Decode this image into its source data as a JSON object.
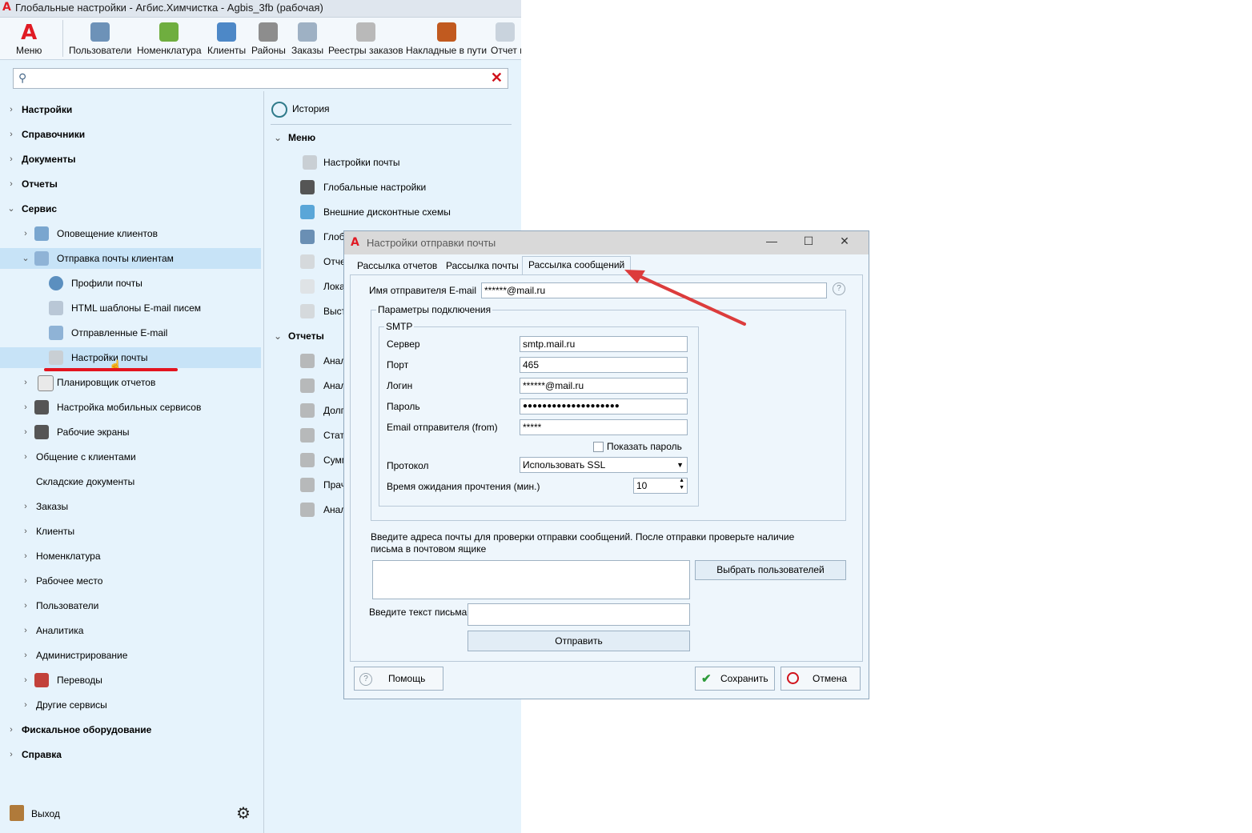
{
  "window": {
    "title": "Глобальные настройки - Агбис.Химчистка - Agbis_3fb (рабочая)"
  },
  "ribbon": {
    "menu_label": "Меню",
    "items": [
      "Пользователи",
      "Номенклатура",
      "Клиенты",
      "Районы",
      "Заказы",
      "Реестры заказов",
      "Накладные в пути",
      "Отчет в"
    ]
  },
  "search": {
    "value": ""
  },
  "nav": {
    "top": [
      "Настройки",
      "Справочники",
      "Документы",
      "Отчеты"
    ],
    "service": "Сервис",
    "service_items": [
      "Оповещение клиентов",
      "Отправка почты клиентам"
    ],
    "mail_children": [
      "Профили почты",
      "HTML шаблоны E-mail писем",
      "Отправленные E-mail",
      "Настройки почты"
    ],
    "service_rest": [
      "Планировщик отчетов",
      "Настройка мобильных сервисов",
      "Рабочие экраны",
      "Общение с клиентами",
      "Складские документы",
      "Заказы",
      "Клиенты",
      "Номенклатура",
      "Рабочее место",
      "Пользователи",
      "Аналитика",
      "Администрирование",
      "Переводы",
      "Другие сервисы"
    ],
    "bottom": [
      "Фискальное оборудование",
      "Справка"
    ],
    "exit": "Выход"
  },
  "right_panel": {
    "history": "История",
    "menu_header": "Меню",
    "menu_items": [
      "Настройки почты",
      "Глобальные настройки",
      "Внешние дисконтные схемы",
      "Глоб",
      "Отче",
      "Лока",
      "Выст"
    ],
    "reports_header": "Отчеты",
    "report_items": [
      "Анал",
      "Анал",
      "Долг",
      "Стат",
      "Сумм",
      "Прач",
      "Анал"
    ]
  },
  "dialog": {
    "title": "Настройки отправки почты",
    "tabs": [
      "Рассылка отчетов",
      "Рассылка почты",
      "Рассылка сообщений"
    ],
    "sender_label": "Имя отправителя E-mail",
    "sender_value": "******@mail.ru",
    "conn_group": "Параметры подключения",
    "smtp_group": "SMTP",
    "fields": {
      "server_label": "Сервер",
      "server_value": "smtp.mail.ru",
      "port_label": "Порт",
      "port_value": "465",
      "login_label": "Логин",
      "login_value": "******@mail.ru",
      "password_label": "Пароль",
      "password_value": "●●●●●●●●●●●●●●●●●●●●",
      "from_label": "Email отправителя (from)",
      "from_value": "*****",
      "show_password": "Показать пароль",
      "protocol_label": "Протокол",
      "protocol_value": "Использовать SSL",
      "timeout_label": "Время ожидания прочтения (мин.)",
      "timeout_value": "10"
    },
    "test_hint": "Введите адреса почты для проверки отправки сообщений. После отправки проверьте наличие письма в почтовом ящике",
    "select_users": "Выбрать пользователей",
    "letter_label": "Введите текст письма",
    "send": "Отправить",
    "help": "Помощь",
    "save": "Сохранить",
    "cancel": "Отмена"
  }
}
